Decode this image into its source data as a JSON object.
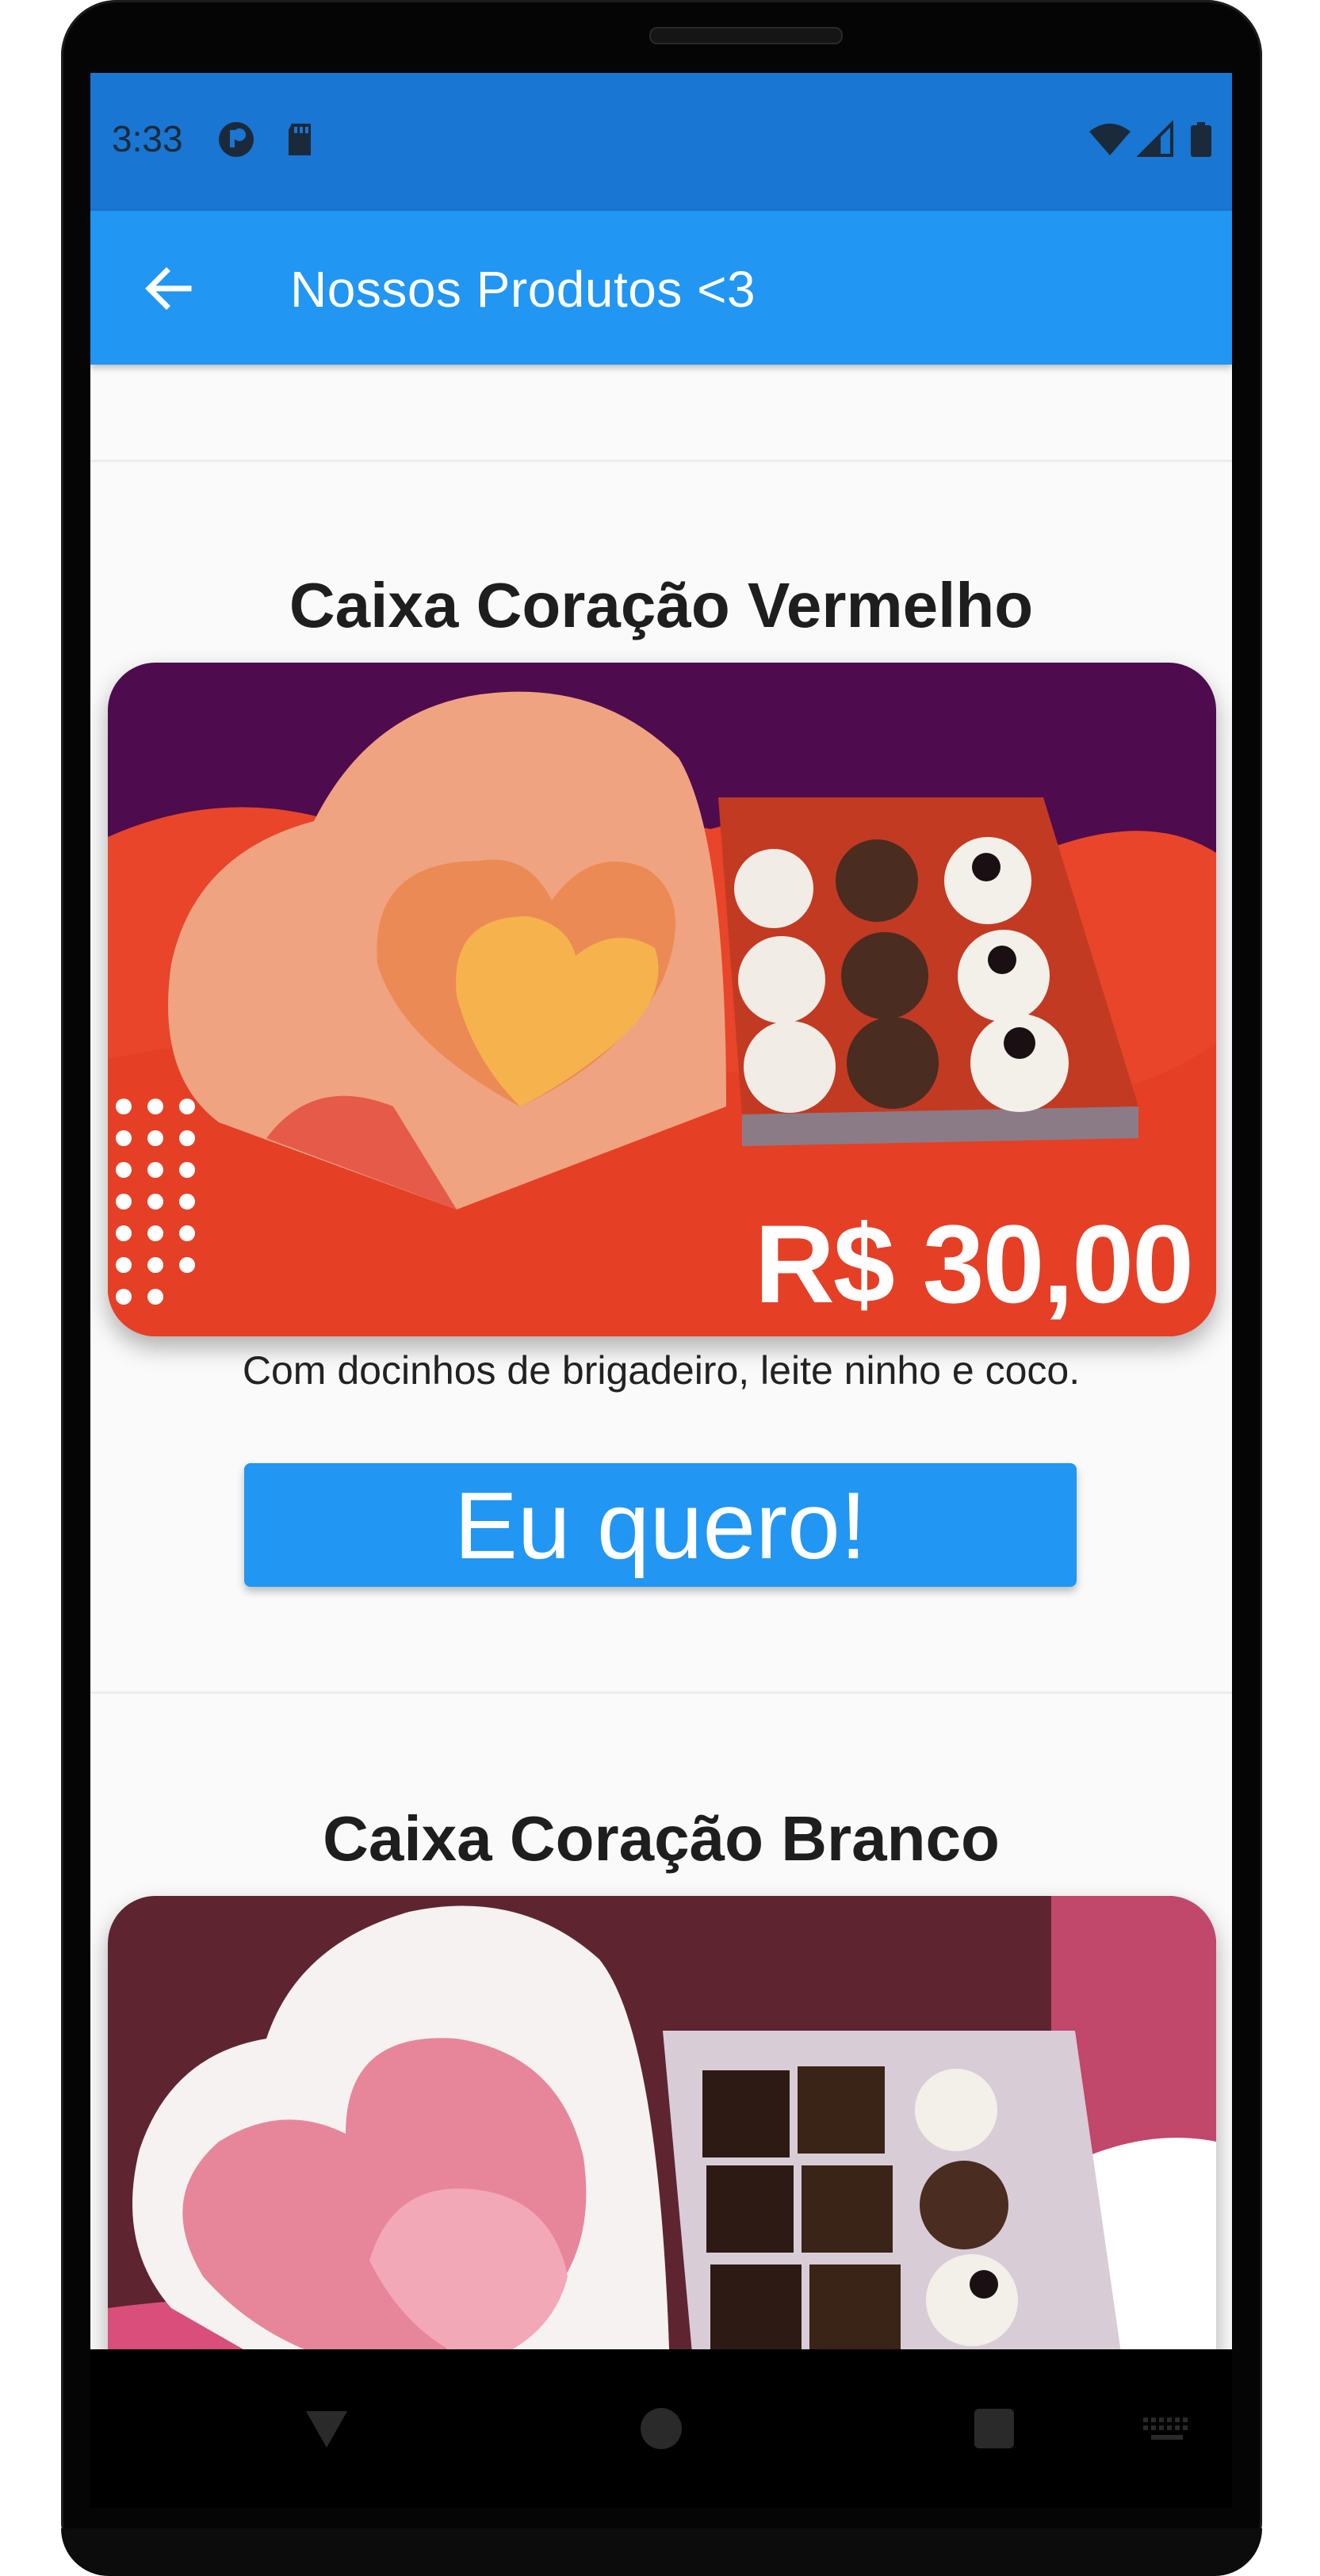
{
  "status_bar": {
    "time": "3:33",
    "icons": [
      "lens-icon",
      "sd-card-icon",
      "wifi-icon",
      "signal-icon",
      "battery-icon"
    ]
  },
  "app_bar": {
    "back_icon": "arrow-left-icon",
    "title": "Nossos Produtos <3"
  },
  "products": [
    {
      "title": "Caixa Coração Vermelho",
      "image_price_label": "R$ 30,00",
      "description": "Com docinhos de brigadeiro, leite ninho e coco.",
      "button_label": "Eu quero!"
    },
    {
      "title": "Caixa Coração Branco"
    }
  ],
  "nav_bar": {
    "icons": [
      "back-triangle-icon",
      "home-circle-icon",
      "recents-square-icon",
      "keyboard-icon"
    ]
  },
  "colors": {
    "status_bar": "#1976d2",
    "app_bar": "#2196f3",
    "button": "#2196f3",
    "background": "#fafafa"
  }
}
